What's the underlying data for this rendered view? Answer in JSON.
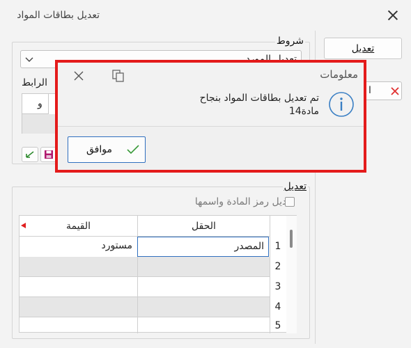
{
  "window": {
    "title": "تعديل بطاقات المواد"
  },
  "right_panel": {
    "edit_button": "تعديل",
    "field_prefix": "ا"
  },
  "conditions": {
    "legend": "شروط",
    "combo_value": "تعديل المورد",
    "link_label": "الرابط",
    "grid_cell": "و"
  },
  "edit": {
    "legend": "تعديل",
    "checkbox_label": "تعديل رمز المادة واسمها",
    "columns": {
      "field": "الحقل",
      "value": "القيمة"
    },
    "rows": [
      {
        "num": "1",
        "field": "المصدر",
        "value": "مستورد"
      },
      {
        "num": "2",
        "field": "",
        "value": ""
      },
      {
        "num": "3",
        "field": "",
        "value": ""
      },
      {
        "num": "4",
        "field": "",
        "value": ""
      },
      {
        "num": "5",
        "field": "",
        "value": ""
      }
    ]
  },
  "dialog": {
    "title": "معلومات",
    "message_line1": "تم تعديل بطاقات المواد بنجاح",
    "message_line2": "14مادة",
    "ok_label": "موافق"
  },
  "colors": {
    "accent": "#2f6fbf",
    "highlight": "#e41b1b",
    "check": "#3a9a3a",
    "info": "#3a7fc4"
  }
}
